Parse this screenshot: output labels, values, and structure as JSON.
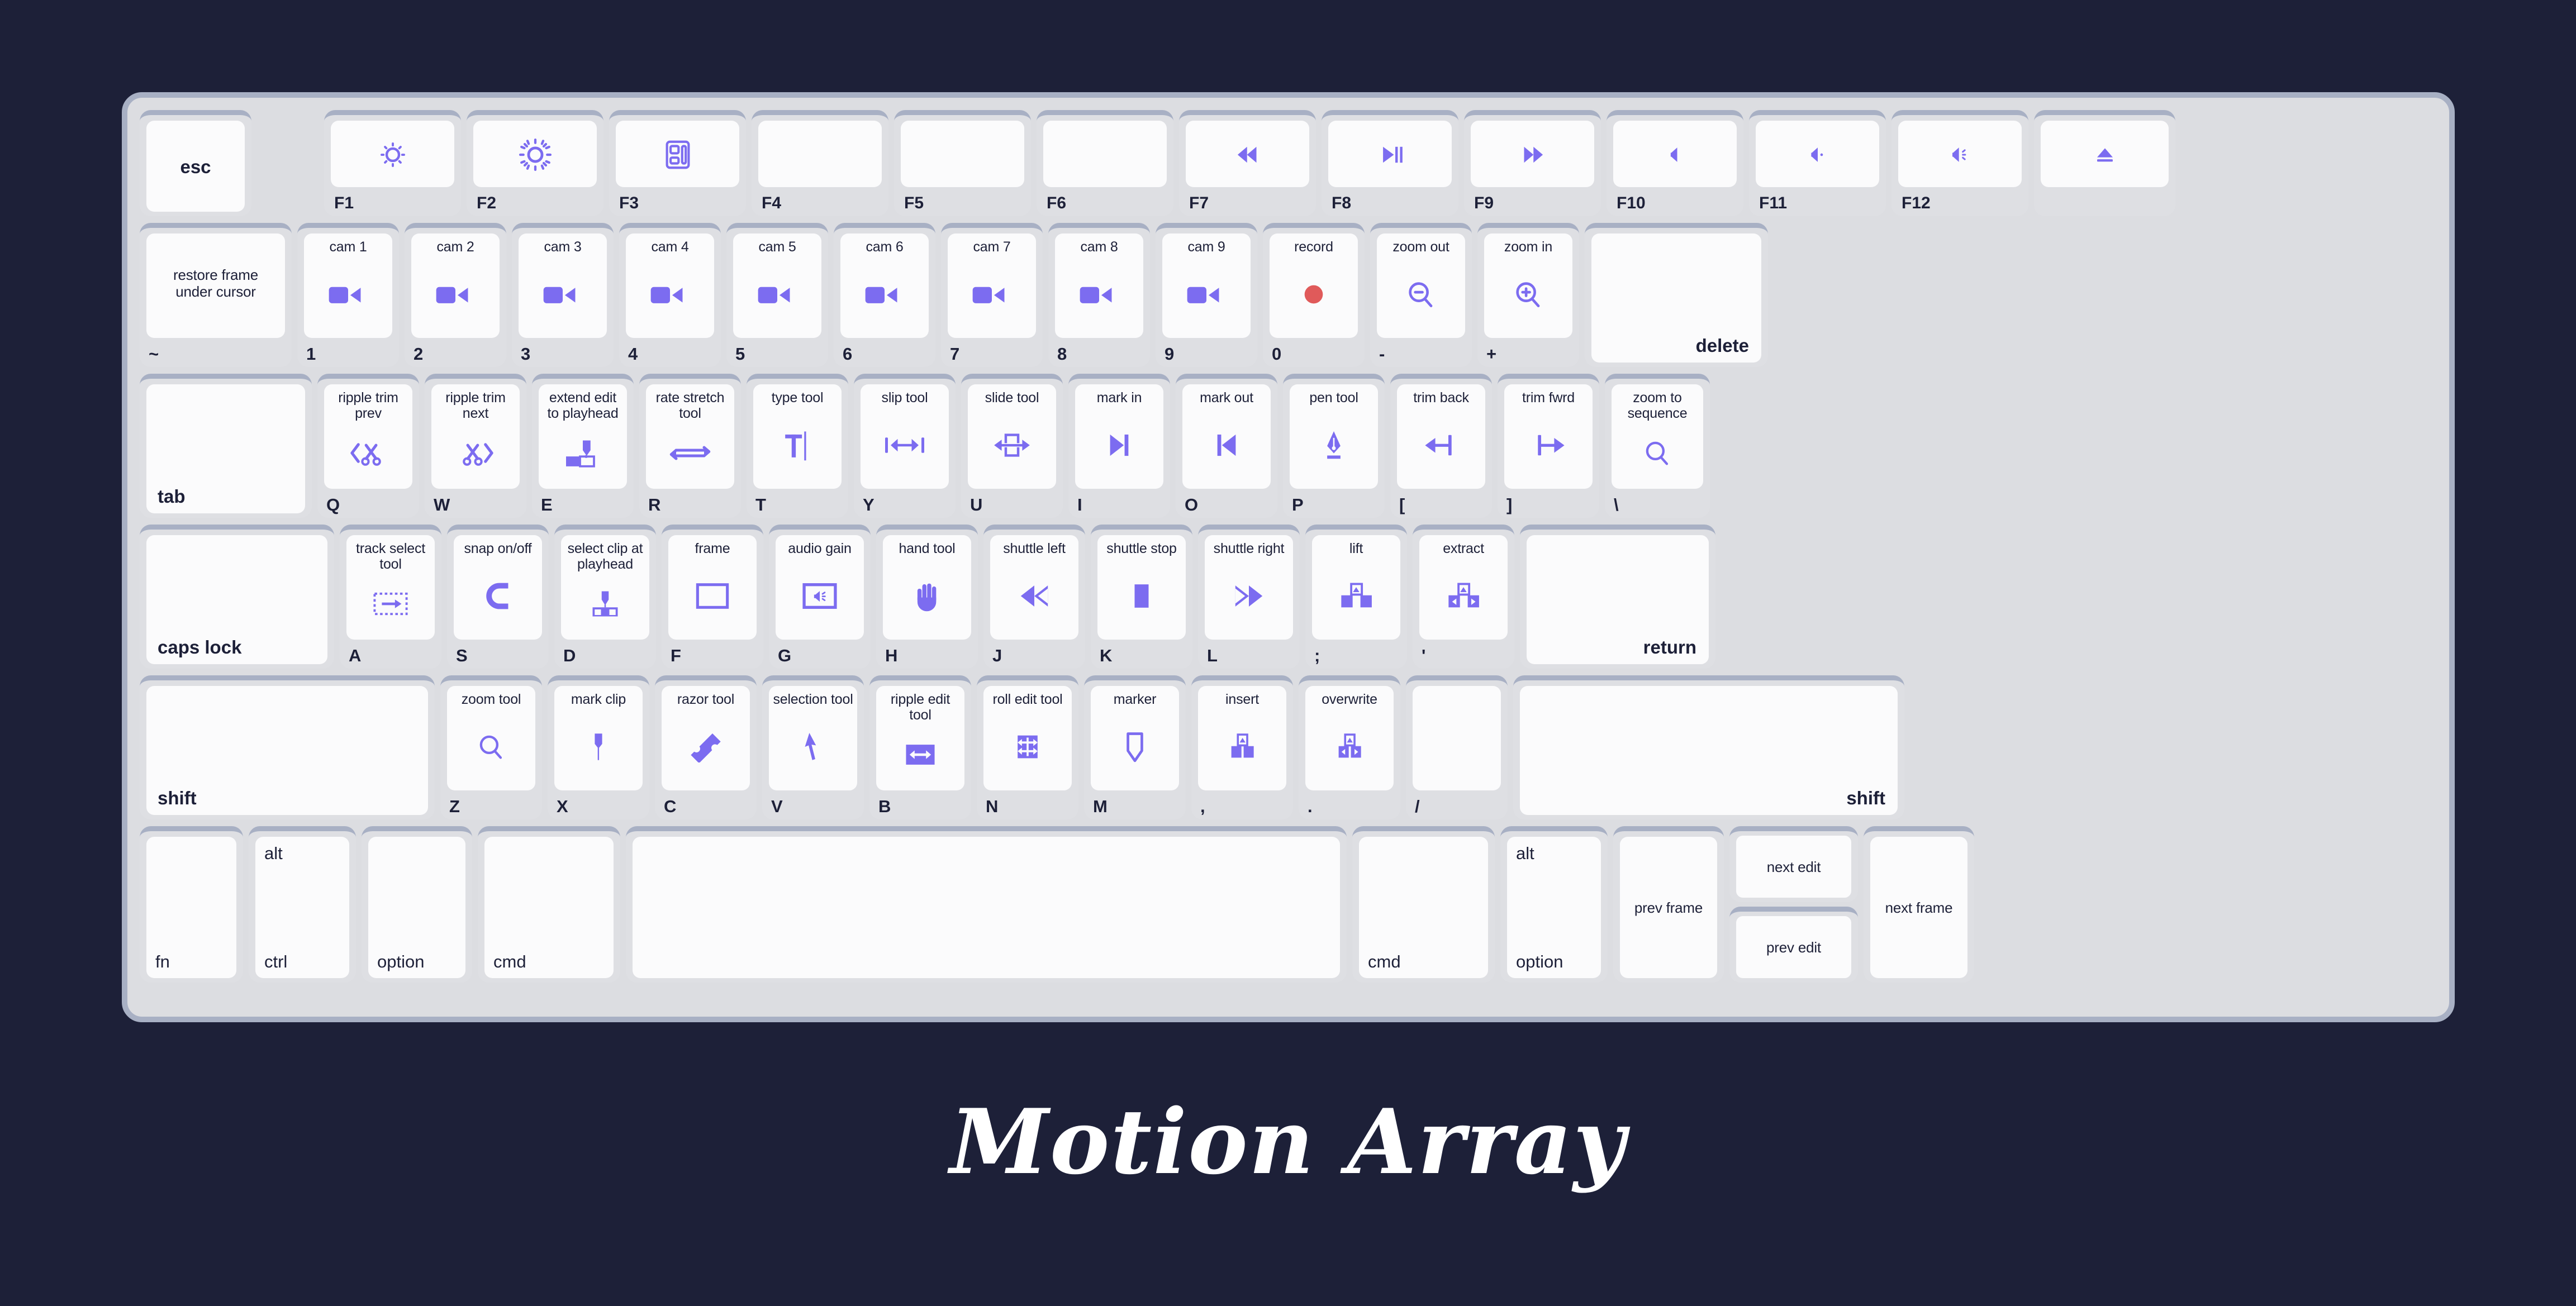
{
  "theme": {
    "background": "#1d2038",
    "chassis": "#dcdde1",
    "chassis_border": "#a8b0c4",
    "keycap": "#fbfbfc",
    "accent": "#7c6cf0",
    "text": "#1d2038",
    "record_red": "#e05a5a"
  },
  "brand": {
    "name": "Motion Array"
  },
  "rows": {
    "function": [
      {
        "legend": "esc",
        "sub": "",
        "icon": ""
      },
      {
        "legend": "",
        "sub": "F1",
        "icon": "brightness-low-icon"
      },
      {
        "legend": "",
        "sub": "F2",
        "icon": "brightness-high-icon"
      },
      {
        "legend": "",
        "sub": "F3",
        "icon": "mission-control-icon"
      },
      {
        "legend": "",
        "sub": "F4",
        "icon": ""
      },
      {
        "legend": "",
        "sub": "F5",
        "icon": ""
      },
      {
        "legend": "",
        "sub": "F6",
        "icon": ""
      },
      {
        "legend": "",
        "sub": "F7",
        "icon": "rewind-icon"
      },
      {
        "legend": "",
        "sub": "F8",
        "icon": "play-pause-icon"
      },
      {
        "legend": "",
        "sub": "F9",
        "icon": "fast-forward-icon"
      },
      {
        "legend": "",
        "sub": "F10",
        "icon": "mute-icon"
      },
      {
        "legend": "",
        "sub": "F11",
        "icon": "volume-down-icon"
      },
      {
        "legend": "",
        "sub": "F12",
        "icon": "volume-up-icon"
      },
      {
        "legend": "",
        "sub": "",
        "icon": "eject-icon"
      }
    ],
    "number": [
      {
        "caption": "restore frame\nunder cursor",
        "sub": "~",
        "icon": ""
      },
      {
        "caption": "cam 1",
        "sub": "1",
        "icon": "camera-icon"
      },
      {
        "caption": "cam 2",
        "sub": "2",
        "icon": "camera-icon"
      },
      {
        "caption": "cam 3",
        "sub": "3",
        "icon": "camera-icon"
      },
      {
        "caption": "cam 4",
        "sub": "4",
        "icon": "camera-icon"
      },
      {
        "caption": "cam 5",
        "sub": "5",
        "icon": "camera-icon"
      },
      {
        "caption": "cam 6",
        "sub": "6",
        "icon": "camera-icon"
      },
      {
        "caption": "cam 7",
        "sub": "7",
        "icon": "camera-icon"
      },
      {
        "caption": "cam 8",
        "sub": "8",
        "icon": "camera-icon"
      },
      {
        "caption": "cam 9",
        "sub": "9",
        "icon": "camera-icon"
      },
      {
        "caption": "record",
        "sub": "0",
        "icon": "record-dot-icon"
      },
      {
        "caption": "zoom out",
        "sub": "-",
        "icon": "zoom-out-icon"
      },
      {
        "caption": "zoom in",
        "sub": "+",
        "icon": "zoom-in-icon"
      },
      {
        "caption": "delete",
        "sub": "",
        "icon": ""
      }
    ],
    "top": [
      {
        "caption": "tab",
        "sub": "",
        "icon": ""
      },
      {
        "caption": "ripple trim\nprev",
        "sub": "Q",
        "icon": "ripple-trim-prev-icon"
      },
      {
        "caption": "ripple trim\nnext",
        "sub": "W",
        "icon": "ripple-trim-next-icon"
      },
      {
        "caption": "extend edit\nto playhead",
        "sub": "E",
        "icon": "extend-edit-icon"
      },
      {
        "caption": "rate stretch\ntool",
        "sub": "R",
        "icon": "rate-stretch-icon"
      },
      {
        "caption": "type tool",
        "sub": "T",
        "icon": "type-tool-icon"
      },
      {
        "caption": "slip tool",
        "sub": "Y",
        "icon": "slip-tool-icon"
      },
      {
        "caption": "slide tool",
        "sub": "U",
        "icon": "slide-tool-icon"
      },
      {
        "caption": "mark in",
        "sub": "I",
        "icon": "mark-in-icon"
      },
      {
        "caption": "mark out",
        "sub": "O",
        "icon": "mark-out-icon"
      },
      {
        "caption": "pen tool",
        "sub": "P",
        "icon": "pen-tool-icon"
      },
      {
        "caption": "trim back",
        "sub": "[",
        "icon": "trim-back-icon"
      },
      {
        "caption": "trim fwrd",
        "sub": "]",
        "icon": "trim-forward-icon"
      },
      {
        "caption": "zoom to\nsequence",
        "sub": "\\",
        "icon": "zoom-to-sequence-icon"
      }
    ],
    "home": [
      {
        "caption": "caps lock",
        "sub": "",
        "icon": ""
      },
      {
        "caption": "track select\ntool",
        "sub": "A",
        "icon": "track-select-icon"
      },
      {
        "caption": "snap on/off",
        "sub": "S",
        "icon": "magnet-icon"
      },
      {
        "caption": "select clip at\nplayhead",
        "sub": "D",
        "icon": "select-clip-icon"
      },
      {
        "caption": "frame",
        "sub": "F",
        "icon": "frame-icon"
      },
      {
        "caption": "audio gain",
        "sub": "G",
        "icon": "audio-gain-icon"
      },
      {
        "caption": "hand tool",
        "sub": "H",
        "icon": "hand-icon"
      },
      {
        "caption": "shuttle left",
        "sub": "J",
        "icon": "shuttle-left-icon"
      },
      {
        "caption": "shuttle stop",
        "sub": "K",
        "icon": "shuttle-stop-icon"
      },
      {
        "caption": "shuttle right",
        "sub": "L",
        "icon": "shuttle-right-icon"
      },
      {
        "caption": "lift",
        "sub": ";",
        "icon": "lift-icon"
      },
      {
        "caption": "extract",
        "sub": "'",
        "icon": "extract-icon"
      },
      {
        "caption": "return",
        "sub": "",
        "icon": ""
      }
    ],
    "bottom_letters": [
      {
        "caption": "shift",
        "sub": "",
        "icon": ""
      },
      {
        "caption": "zoom tool",
        "sub": "Z",
        "icon": "zoom-tool-icon"
      },
      {
        "caption": "mark clip",
        "sub": "X",
        "icon": "mark-clip-icon"
      },
      {
        "caption": "razor tool",
        "sub": "C",
        "icon": "razor-tool-icon"
      },
      {
        "caption": "selection tool",
        "sub": "V",
        "icon": "selection-tool-icon"
      },
      {
        "caption": "ripple edit\ntool",
        "sub": "B",
        "icon": "ripple-edit-icon"
      },
      {
        "caption": "roll edit tool",
        "sub": "N",
        "icon": "roll-edit-icon"
      },
      {
        "caption": "marker",
        "sub": "M",
        "icon": "marker-icon"
      },
      {
        "caption": "insert",
        "sub": ",",
        "icon": "insert-icon"
      },
      {
        "caption": "overwrite",
        "sub": ".",
        "icon": "overwrite-icon"
      },
      {
        "caption": "",
        "sub": "/",
        "icon": ""
      },
      {
        "caption": "shift",
        "sub": "",
        "icon": ""
      }
    ],
    "modifier": {
      "fn": "fn",
      "ctrl_top": "alt",
      "ctrl_bottom": "ctrl",
      "option_left": "option",
      "cmd_left": "cmd",
      "space": "",
      "cmd_right": "cmd",
      "option_top": "alt",
      "option_bottom": "option",
      "prev_frame": "prev frame",
      "next_edit": "next edit",
      "prev_edit": "prev edit",
      "next_frame": "next frame"
    }
  }
}
